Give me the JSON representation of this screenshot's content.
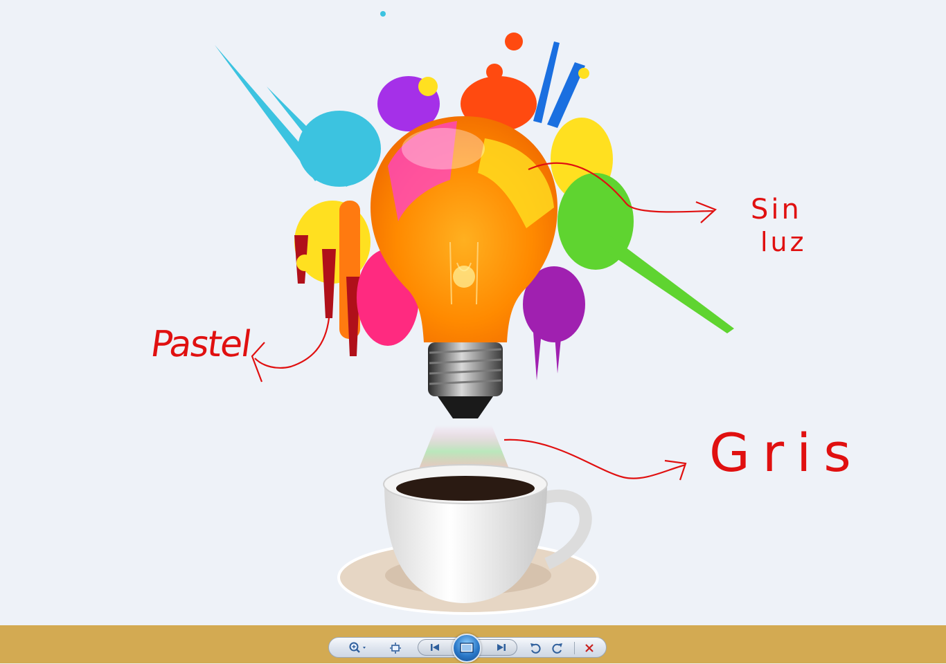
{
  "annotations": {
    "left_label": "Pastel",
    "right_top_line1": "Sin",
    "right_top_line2": "luz",
    "right_bottom": "Gris"
  },
  "colors": {
    "annotation_ink": "#e01010",
    "canvas_background": "#eef2f8",
    "taskbar": "#d3aa52",
    "toolbar_accent": "#2f5f9c",
    "delete_red": "#c8201e"
  },
  "toolbar": {
    "zoom": "zoom-magnifier-icon",
    "fit": "actual-size-icon",
    "previous": "previous-icon",
    "slideshow": "slideshow-icon",
    "next": "next-icon",
    "rotate_left": "rotate-counterclockwise-icon",
    "rotate_right": "rotate-clockwise-icon",
    "delete": "delete-icon"
  }
}
